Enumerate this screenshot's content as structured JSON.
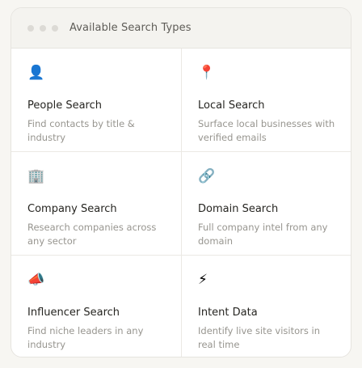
{
  "window": {
    "title": "Available Search Types"
  },
  "search_types": [
    {
      "icon": "person-silhouette-icon",
      "glyph": "👤",
      "title": "People Search",
      "description": "Find contacts by title & industry"
    },
    {
      "icon": "map-pin-icon",
      "glyph": "📍",
      "title": "Local Search",
      "description": "Surface local businesses with verified emails"
    },
    {
      "icon": "office-building-icon",
      "glyph": "🏢",
      "title": "Company Search",
      "description": "Research companies across any sector"
    },
    {
      "icon": "chain-link-icon",
      "glyph": "🔗",
      "title": "Domain Search",
      "description": "Full company intel from any domain"
    },
    {
      "icon": "megaphone-icon",
      "glyph": "📣",
      "title": "Influencer Search",
      "description": "Find niche leaders in any industry"
    },
    {
      "icon": "lightning-bolt-icon",
      "glyph": "⚡",
      "title": "Intent Data",
      "description": "Identify live site visitors in real time"
    }
  ]
}
